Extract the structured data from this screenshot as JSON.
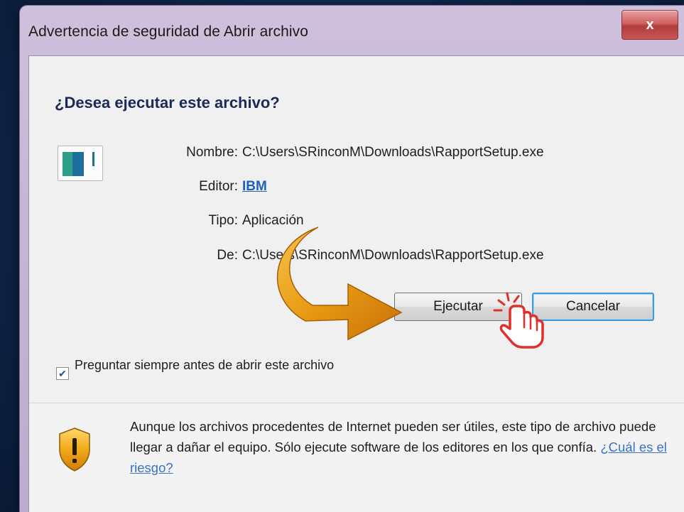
{
  "window": {
    "title": "Advertencia de seguridad de Abrir archivo",
    "close_label": "x"
  },
  "dialog": {
    "question": "¿Desea ejecutar este archivo?",
    "name_label": "Nombre:",
    "name_value": "C:\\Users\\SRinconM\\Downloads\\RapportSetup.exe",
    "publisher_label": "Editor:",
    "publisher_value": "IBM",
    "type_label": "Tipo:",
    "type_value": "Aplicación",
    "from_label": "De:",
    "from_value": "C:\\Users\\SRinconM\\Downloads\\RapportSetup.exe"
  },
  "buttons": {
    "run": "Ejecutar",
    "cancel": "Cancelar"
  },
  "checkbox": {
    "label": "Preguntar siempre antes de abrir este archivo",
    "checked": true
  },
  "warning": {
    "text": "Aunque los archivos procedentes de Internet pueden ser útiles, este tipo de archivo puede llegar a dañar el equipo. Sólo ejecute software de los editores en los que confía.",
    "risk_link": "¿Cuál es el riesgo?"
  },
  "icons": {
    "file": "application-file-icon",
    "shield": "warning-shield-icon",
    "arrow": "curved-arrow-icon",
    "hand": "pointing-hand-cursor-icon"
  },
  "colors": {
    "accent_arrow": "#e7a21a",
    "hand_outline": "#e0302e",
    "link": "#1f5fbf"
  }
}
